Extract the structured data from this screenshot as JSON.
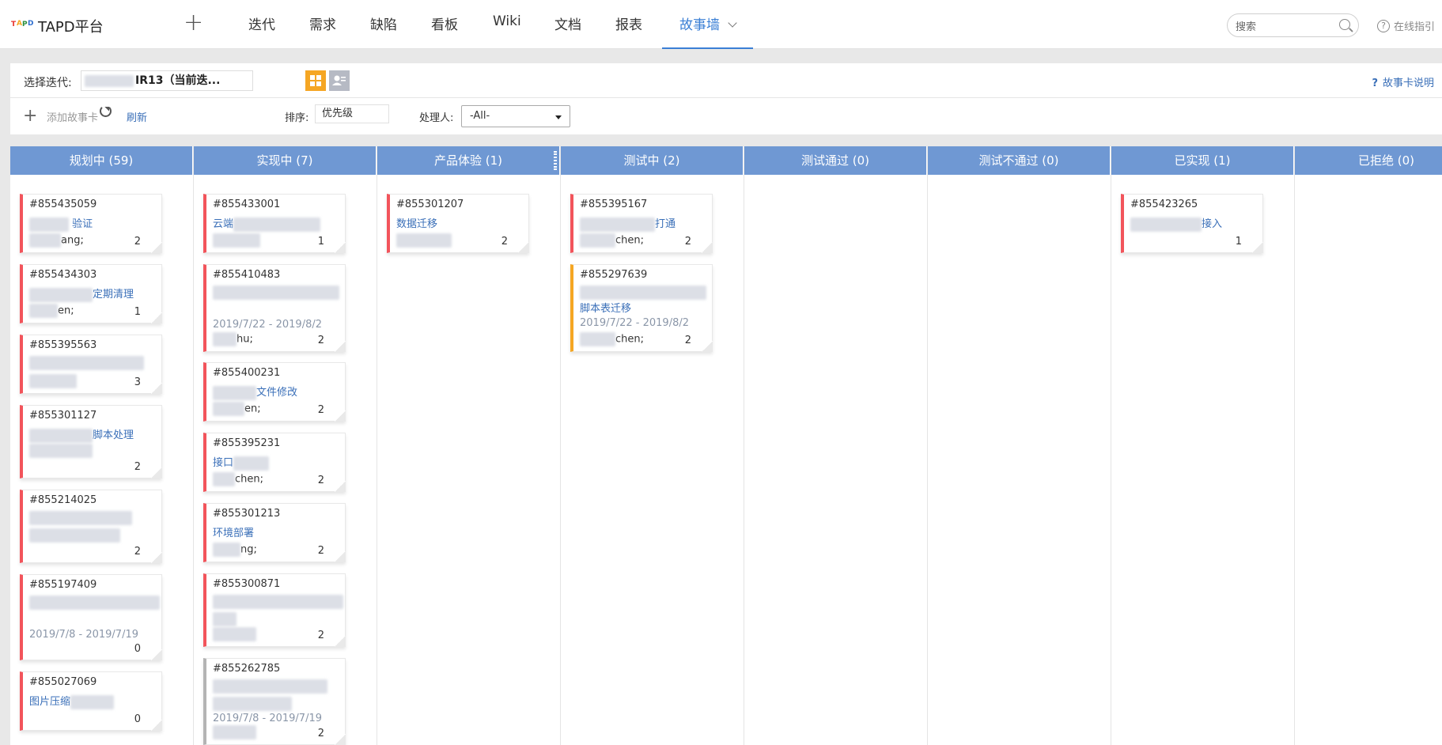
{
  "app": {
    "name": "TAPD平台",
    "logo_text": "TAPD"
  },
  "nav": {
    "items": [
      "迭代",
      "需求",
      "缺陷",
      "看板",
      "Wiki",
      "文档",
      "报表"
    ],
    "active": "故事墙",
    "search_placeholder": "搜索",
    "help": "在线指引"
  },
  "toolbar": {
    "iteration_label": "选择迭代:",
    "iteration_value": "IR13（当前迭...",
    "story_help": "故事卡说明",
    "add_label": "添加故事卡",
    "refresh_label": "刷新",
    "sort_label": "排序:",
    "sort_value": "优先级",
    "owner_label": "处理人:",
    "owner_value": "-All-"
  },
  "columns": [
    {
      "title": "规划中 (59)",
      "cards": [
        {
          "id": "#855435059",
          "title": "验证",
          "owner": "ang;",
          "count": "2",
          "color": "red"
        },
        {
          "id": "#855434303",
          "title": "定期清理",
          "owner": "en;",
          "count": "1",
          "color": "red"
        },
        {
          "id": "#855395563",
          "title": "",
          "owner": "",
          "count": "3",
          "color": "red"
        },
        {
          "id": "#855301127",
          "title": "脚本处理",
          "owner": "",
          "count": "2",
          "color": "red"
        },
        {
          "id": "#855214025",
          "title": "",
          "owner": "",
          "count": "2",
          "color": "red"
        },
        {
          "id": "#855197409",
          "title": "",
          "date": "2019/7/8 - 2019/7/19",
          "owner": "",
          "count": "0",
          "color": "red"
        },
        {
          "id": "#855027069",
          "title": "图片压缩",
          "owner": "",
          "count": "0",
          "color": "red"
        }
      ]
    },
    {
      "title": "实现中 (7)",
      "cards": [
        {
          "id": "#855433001",
          "title": "云端",
          "owner": "",
          "count": "1",
          "color": "red"
        },
        {
          "id": "#855410483",
          "title": "",
          "date": "2019/7/22 - 2019/8/2",
          "owner": "hu;",
          "count": "2",
          "color": "red"
        },
        {
          "id": "#855400231",
          "title": "文件修改",
          "owner": "en;",
          "count": "2",
          "color": "red"
        },
        {
          "id": "#855395231",
          "title": "接口",
          "owner": "chen;",
          "count": "2",
          "color": "red"
        },
        {
          "id": "#855301213",
          "title": "环境部署",
          "owner": "ng;",
          "count": "2",
          "color": "red"
        },
        {
          "id": "#855300871",
          "title": "",
          "owner": "",
          "count": "2",
          "color": "red"
        },
        {
          "id": "#855262785",
          "title": "",
          "date": "2019/7/8 - 2019/7/19",
          "owner": "",
          "count": "2",
          "color": "gray"
        }
      ]
    },
    {
      "title": "产品体验 (1)",
      "cards": [
        {
          "id": "#855301207",
          "title": "数据迁移",
          "owner": "",
          "count": "2",
          "color": "red"
        }
      ]
    },
    {
      "title": "测试中 (2)",
      "cards": [
        {
          "id": "#855395167",
          "title": "打通",
          "owner": "chen;",
          "count": "2",
          "color": "red"
        },
        {
          "id": "#855297639",
          "title": "脚本表迁移",
          "date": "2019/7/22 - 2019/8/2",
          "owner": "chen;",
          "count": "2",
          "color": "orange"
        }
      ]
    },
    {
      "title": "测试通过 (0)",
      "cards": []
    },
    {
      "title": "测试不通过 (0)",
      "cards": []
    },
    {
      "title": "已实现 (1)",
      "cards": [
        {
          "id": "#855423265",
          "title": "接入",
          "owner": "",
          "count": "1",
          "color": "red"
        }
      ]
    },
    {
      "title": "已拒绝 (0)",
      "cards": []
    }
  ]
}
